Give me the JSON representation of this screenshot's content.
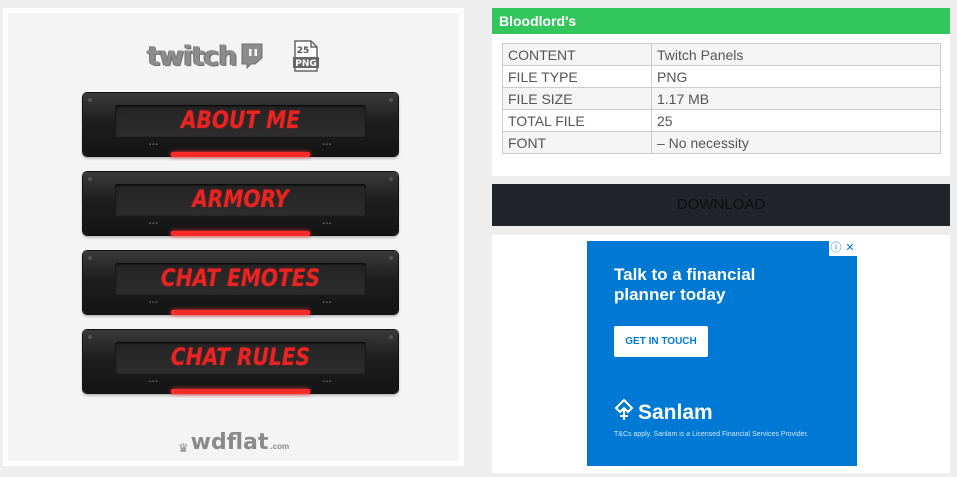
{
  "preview": {
    "logo_text": "twitch",
    "badge": {
      "number": "25",
      "format": "PNG"
    },
    "panels": [
      {
        "label": "ABOUT ME"
      },
      {
        "label": "ARMORY"
      },
      {
        "label": "CHAT EMOTES"
      },
      {
        "label": "CHAT RULES"
      }
    ],
    "brand": {
      "name": "wdflat",
      "tld": ".com"
    }
  },
  "info": {
    "title": "Bloodlord's",
    "rows": [
      {
        "key": "CONTENT",
        "value": "Twitch Panels"
      },
      {
        "key": "FILE TYPE",
        "value": "PNG"
      },
      {
        "key": "FILE SIZE",
        "value": "1.17 MB"
      },
      {
        "key": "TOTAL FILE",
        "value": "25"
      },
      {
        "key": "FONT",
        "value": "– No necessity"
      }
    ]
  },
  "download": {
    "label": "DOWNLOAD"
  },
  "ad": {
    "headline": "Talk to a financial planner today",
    "cta": "GET IN TOUCH",
    "brand": "Sanlam",
    "fine_print": "T&Cs apply. Sanlam is a Licensed Financial Services Provider.",
    "choices_icons": [
      "info-icon",
      "close-icon"
    ]
  },
  "colors": {
    "accent_green": "#33c65d",
    "panel_red": "#ea2323",
    "ad_blue": "#0079d5",
    "button_dark": "#212529"
  }
}
